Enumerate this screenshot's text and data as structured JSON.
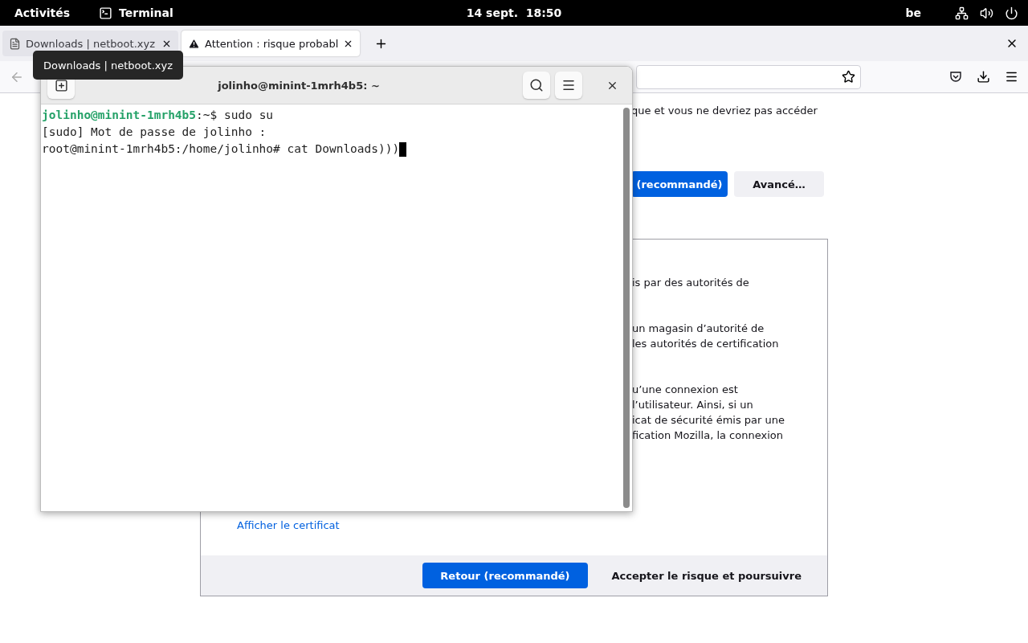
{
  "top_bar": {
    "activities": "Activités",
    "app": "Terminal",
    "clock": "14 sept.  18:50",
    "keyboard_layout": "be"
  },
  "browser": {
    "tabs": [
      {
        "label": "Downloads | netboot.xyz",
        "selected": false,
        "kind": "page"
      },
      {
        "label": "Attention : risque probabl",
        "selected": true,
        "kind": "warning"
      }
    ],
    "tooltip": "Downloads | netboot.xyz",
    "page": {
      "intro_fragment": "que et vous ne devriez pas accéder",
      "buttons": [
        {
          "label": "(recommandé)",
          "kind": "primary"
        },
        {
          "label": "Avancé…",
          "kind": "secondary"
        }
      ],
      "details": {
        "paragraphs": [
          [
            "is par des autorités de"
          ],
          [
            "un magasin d’autorité de",
            "les autorités de certification"
          ],
          [
            "u’une connexion est",
            "l’utilisateur. Ainsi, si un",
            "icat de sécurité émis par une",
            "fication Mozilla, la connexion"
          ]
        ],
        "link": "Afficher le certificat",
        "buttons": [
          {
            "label": "Retour (recommandé)",
            "kind": "primary"
          },
          {
            "label": "Accepter le risque et poursuivre",
            "kind": "secondary"
          }
        ]
      }
    }
  },
  "terminal": {
    "title": "jolinho@minint-1mrh4b5: ~",
    "lines": [
      {
        "kind": "prompt",
        "user": "jolinho@minint-1mrh4b5",
        "text": ":~$ sudo su",
        "cursor": false
      },
      {
        "kind": "plain",
        "text": "[sudo] Mot de passe de jolinho :",
        "cursor": false
      },
      {
        "kind": "plain",
        "text": "root@minint-1mrh4b5:/home/jolinho# cat Downloads)))",
        "cursor": true
      }
    ]
  }
}
